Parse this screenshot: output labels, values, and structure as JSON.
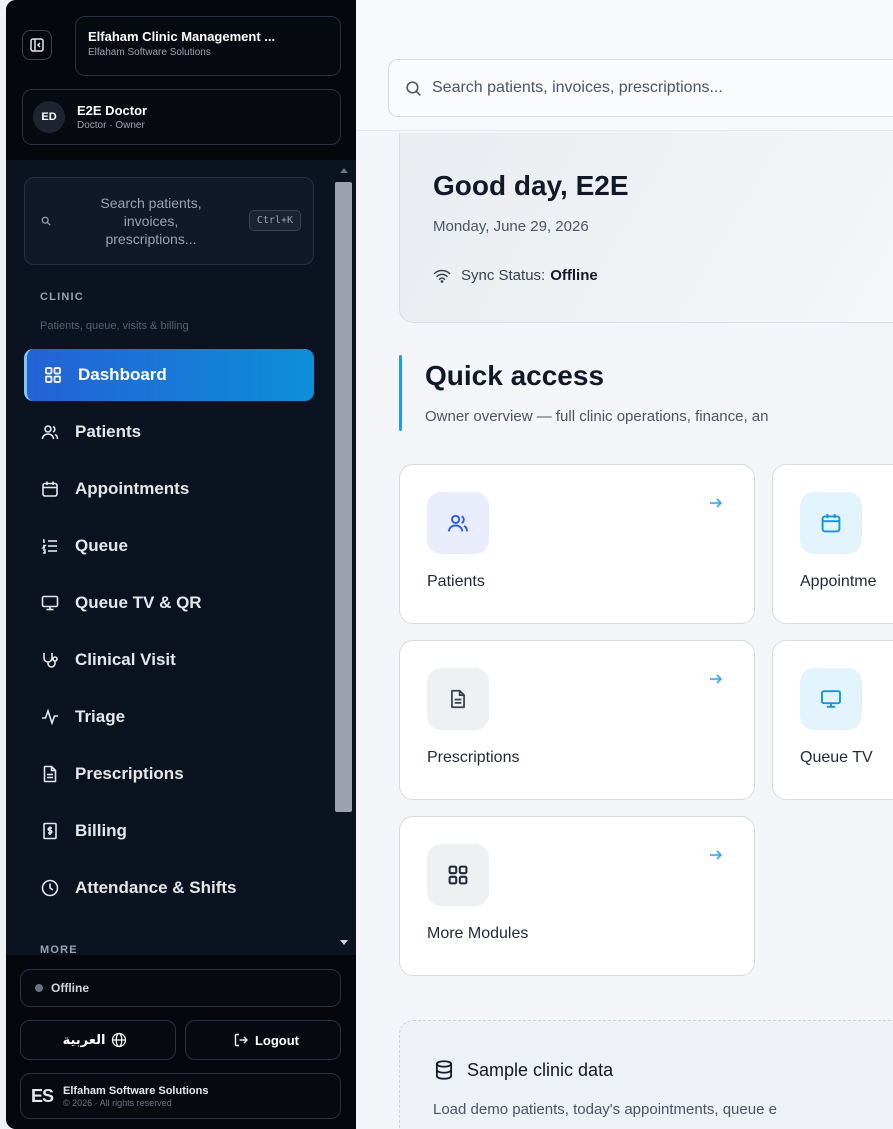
{
  "sidebar": {
    "app_title": "Elfaham Clinic Management ...",
    "app_subtitle": "Elfaham Software Solutions",
    "user": {
      "initials": "ED",
      "name": "E2E Doctor",
      "role": "Doctor · Owner"
    },
    "search": {
      "placeholder": "Search patients, invoices, prescriptions...",
      "shortcut": "Ctrl+K"
    },
    "section_label": "CLINIC",
    "section_subtitle": "Patients, queue, visits & billing",
    "items": [
      {
        "label": "Dashboard",
        "icon": "grid-icon",
        "active": true
      },
      {
        "label": "Patients",
        "icon": "users-icon"
      },
      {
        "label": "Appointments",
        "icon": "calendar-icon"
      },
      {
        "label": "Queue",
        "icon": "list-ordered-icon"
      },
      {
        "label": "Queue TV & QR",
        "icon": "monitor-icon"
      },
      {
        "label": "Clinical Visit",
        "icon": "stethoscope-icon"
      },
      {
        "label": "Triage",
        "icon": "activity-icon"
      },
      {
        "label": "Prescriptions",
        "icon": "file-text-icon"
      },
      {
        "label": "Billing",
        "icon": "receipt-icon"
      },
      {
        "label": "Attendance & Shifts",
        "icon": "clock-icon"
      }
    ],
    "more_label": "MORE",
    "status": "Offline",
    "language_button": "العربية",
    "logout_button": "Logout",
    "brand_logo": "ES",
    "brand_name": "Elfaham Software Solutions",
    "copyright": "© 2026 · All rights reserved"
  },
  "header": {
    "search_placeholder": "Search patients, invoices, prescriptions..."
  },
  "greeting": {
    "title": "Good day, E2E",
    "date": "Monday, June 29, 2026",
    "sync_label": "Sync Status:",
    "sync_value": "Offline"
  },
  "quick_access": {
    "title": "Quick access",
    "subtitle": "Owner overview — full clinic operations, finance, an",
    "tiles": [
      {
        "label": "Patients",
        "icon": "users-icon"
      },
      {
        "label": "Appointme",
        "icon": "calendar-icon"
      },
      {
        "label": "Prescriptions",
        "icon": "file-text-icon"
      },
      {
        "label": "Queue TV",
        "icon": "monitor-icon"
      },
      {
        "label": "More Modules",
        "icon": "grid-icon"
      }
    ]
  },
  "sample_data": {
    "title": "Sample clinic data",
    "description": "Load demo patients, today's appointments, queue e"
  },
  "colors": {
    "accent": "#1d9bf0",
    "active_nav_start": "#2461d6",
    "active_nav_end": "#0d8fd8",
    "sidebar_bg": "#0b1220"
  }
}
